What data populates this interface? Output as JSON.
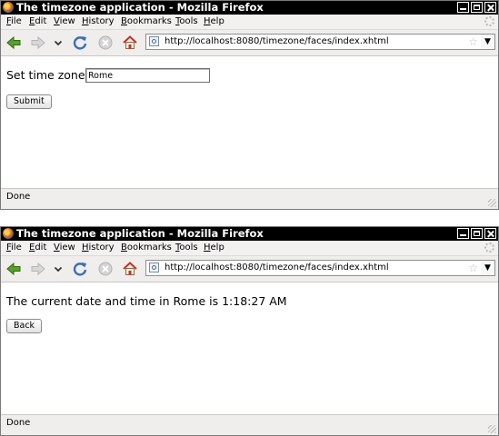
{
  "windows": [
    {
      "title": "The timezone application - Mozilla Firefox",
      "menu": [
        "File",
        "Edit",
        "View",
        "History",
        "Bookmarks",
        "Tools",
        "Help"
      ],
      "url": "http://localhost:8080/timezone/faces/index.xhtml",
      "content": {
        "label": "Set time zone:",
        "input_value": "Rome",
        "button": "Submit"
      },
      "status": "Done"
    },
    {
      "title": "The timezone application - Mozilla Firefox",
      "menu": [
        "File",
        "Edit",
        "View",
        "History",
        "Bookmarks",
        "Tools",
        "Help"
      ],
      "url": "http://localhost:8080/timezone/faces/index.xhtml",
      "content": {
        "message": "The current date and time in Rome is 1:18:27 AM",
        "button": "Back"
      },
      "status": "Done"
    }
  ],
  "icons": [
    "firefox-icon",
    "back-icon",
    "forward-icon",
    "history-dropdown-icon",
    "reload-icon",
    "stop-icon",
    "home-icon",
    "site-identity-icon",
    "bookmark-star-icon",
    "url-dropdown-icon",
    "throbber-icon"
  ],
  "colors": {
    "titlebar": "#000000",
    "toolbar": "#efeeec",
    "back_arrow": "#4e9a06",
    "home": "#c4331f"
  }
}
